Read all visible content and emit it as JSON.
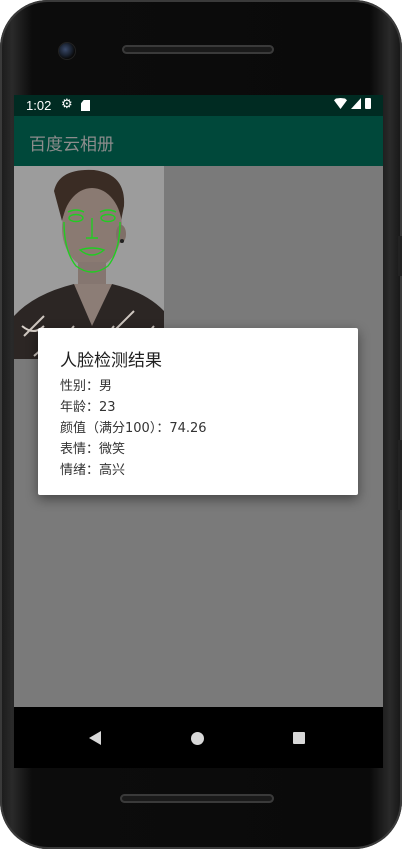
{
  "status_bar": {
    "time": "1:02",
    "icons": [
      "settings-icon",
      "sd-card-icon",
      "wifi-icon",
      "signal-icon",
      "battery-icon"
    ]
  },
  "app_bar": {
    "title": "百度云相册"
  },
  "dialog": {
    "title": "人脸检测结果",
    "lines": [
      "性别：男",
      "年龄：23",
      "颜值（满分100）：74.26",
      "表情：微笑",
      "情绪：高兴"
    ]
  },
  "nav_bar": {
    "icons": [
      "back-icon",
      "home-icon",
      "recents-icon"
    ]
  },
  "colors": {
    "status_bar": "#002b22",
    "app_bar": "#00483a",
    "face_landmarks": "#22cc22",
    "scrim": "#7a7a7a"
  }
}
